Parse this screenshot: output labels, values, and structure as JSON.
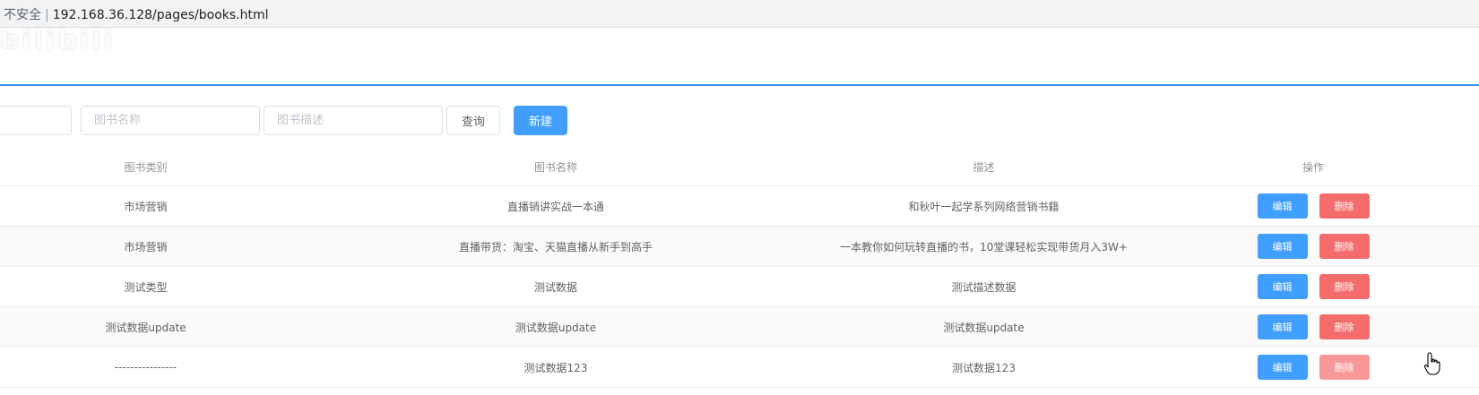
{
  "browser": {
    "insecure_label": "不安全",
    "url": "192.168.36.128/pages/books.html"
  },
  "watermark": "bilibili",
  "toolbar": {
    "type_placeholder": "",
    "name_placeholder": "图书名称",
    "desc_placeholder": "图书描述",
    "query_label": "查询",
    "new_label": "新建"
  },
  "table": {
    "headers": [
      "图书类别",
      "图书名称",
      "描述",
      "操作"
    ],
    "rows": [
      {
        "type": "市场营销",
        "name": "直播销讲实战一本通",
        "desc": "和秋叶一起学系列网络营销书籍"
      },
      {
        "type": "市场营销",
        "name": "直播带货：淘宝、天猫直播从新手到高手",
        "desc": "一本教你如何玩转直播的书，10堂课轻松实现带货月入3W+"
      },
      {
        "type": "测试类型",
        "name": "测试数据",
        "desc": "测试描述数据"
      },
      {
        "type": "测试数据update",
        "name": "测试数据update",
        "desc": "测试数据update"
      },
      {
        "type": "----------------",
        "name": "测试数据123",
        "desc": "测试数据123"
      }
    ],
    "edit_label": "编辑",
    "delete_label": "删除"
  },
  "colors": {
    "primary": "#409eff",
    "danger": "#f56c6c",
    "header_border": "#3a8ee6"
  }
}
